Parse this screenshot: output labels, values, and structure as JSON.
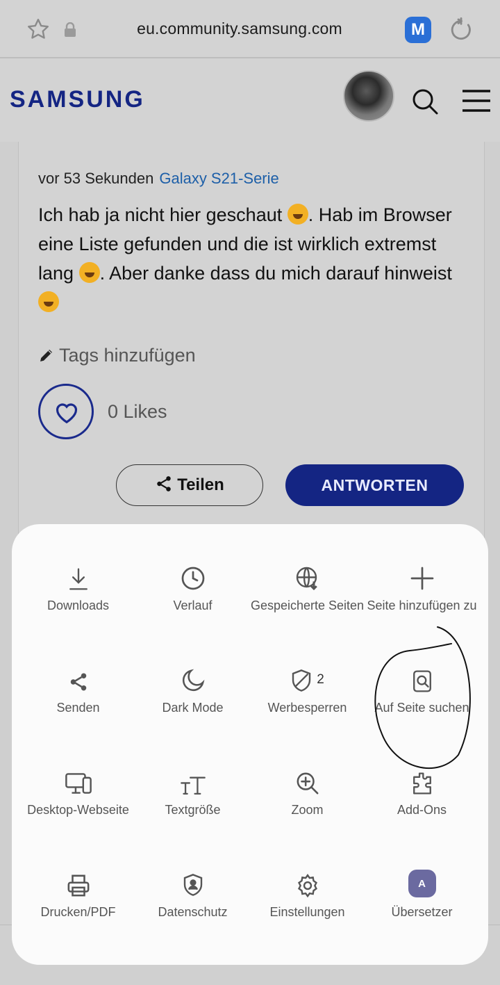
{
  "browser": {
    "url": "eu.community.samsung.com",
    "extension_label": "M"
  },
  "site": {
    "logo": "SAMSUNG"
  },
  "post": {
    "time": "vor 53 Sekunden",
    "board": "Galaxy S21-Serie",
    "text_1": "Ich hab ja nicht hier geschaut ",
    "text_2": ". Hab im Browser eine Liste gefunden und die ist wirklich extremst lang ",
    "text_3": ". Aber danke dass du mich darauf hinweist ",
    "tags_label": "Tags hinzufügen",
    "likes_label": "0 Likes",
    "share_label": "Teilen",
    "reply_label": "ANTWORTEN"
  },
  "menu": {
    "items": [
      {
        "label": "Downloads",
        "icon": "download-icon"
      },
      {
        "label": "Verlauf",
        "icon": "clock-icon"
      },
      {
        "label": "Gespeicherte Seiten",
        "icon": "globe-download-icon"
      },
      {
        "label": "Seite hinzufügen zu",
        "icon": "plus-icon"
      },
      {
        "label": "Senden",
        "icon": "share-icon"
      },
      {
        "label": "Dark Mode",
        "icon": "moon-icon"
      },
      {
        "label": "Werbesperren",
        "icon": "shield-icon",
        "badge": "2"
      },
      {
        "label": "Auf Seite suchen",
        "icon": "find-in-page-icon"
      },
      {
        "label": "Desktop-Webseite",
        "icon": "desktop-icon"
      },
      {
        "label": "Textgröße",
        "icon": "text-size-icon"
      },
      {
        "label": "Zoom",
        "icon": "zoom-icon"
      },
      {
        "label": "Add-Ons",
        "icon": "puzzle-icon"
      },
      {
        "label": "Drucken/PDF",
        "icon": "printer-icon"
      },
      {
        "label": "Datenschutz",
        "icon": "privacy-shield-icon"
      },
      {
        "label": "Einstellungen",
        "icon": "gear-icon"
      },
      {
        "label": "Übersetzer",
        "icon": "translate-icon",
        "icon_text": "A"
      }
    ]
  },
  "colors": {
    "brand": "#142583",
    "link": "#1d5fa8",
    "sheet": "#fbfbfb",
    "dimmed_bg": "#d3d3d3"
  }
}
